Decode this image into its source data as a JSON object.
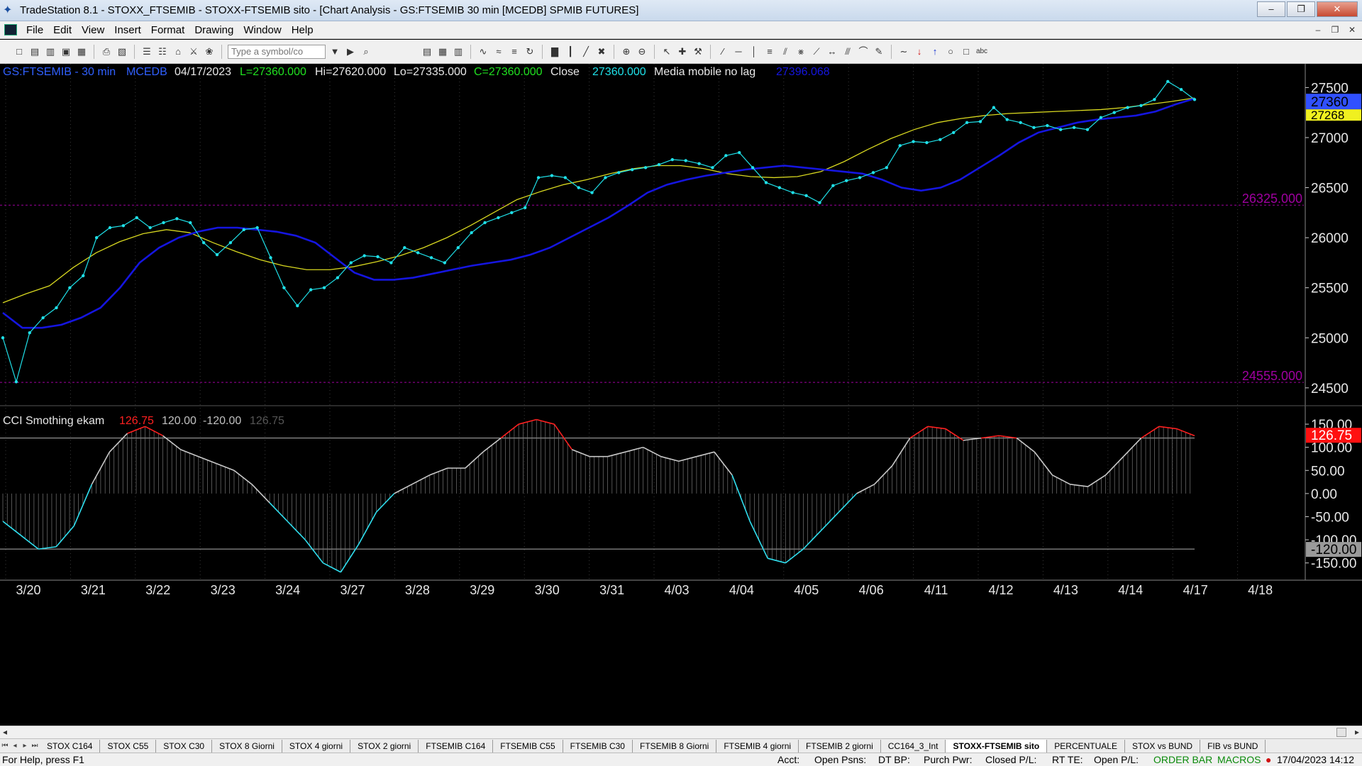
{
  "window": {
    "title": "TradeStation 8.1 - STOXX_FTSEMIB - STOXX-FTSEMIB sito - [Chart Analysis - GS:FTSEMIB  30 min  [MCEDB] SPMIB FUTURES]"
  },
  "menu": [
    "File",
    "Edit",
    "View",
    "Insert",
    "Format",
    "Drawing",
    "Window",
    "Help"
  ],
  "toolbar": {
    "symbol_placeholder": "Type a symbol/co"
  },
  "chart_header": {
    "symbol": "GS:FTSEMIB - 30 min",
    "exchange": "MCEDB",
    "date": "04/17/2023",
    "last": "L=27360.000",
    "high": "Hi=27620.000",
    "low": "Lo=27335.000",
    "close": "C=27360.000",
    "close_label": "Close",
    "close_value": "27360.000",
    "ma_label": "Media mobile no lag",
    "ma_value": "27396.068"
  },
  "cci_header": {
    "label": "CCI Smothing ekam",
    "value": "126.75",
    "upper": "120.00",
    "lower": "-120.00",
    "value2": "126.75"
  },
  "price_axis": {
    "ticks": [
      "27500",
      "27000",
      "26500",
      "26000",
      "25500",
      "25000",
      "24500"
    ],
    "tag_close": "27360",
    "tag_ma": "27268",
    "level_high": "26325.000",
    "level_low": "24555.000"
  },
  "cci_axis": {
    "ticks": [
      "150.00",
      "100.00",
      "50.00",
      "0.00",
      "-50.00",
      "-100.00",
      "-150.00"
    ],
    "tag_value": "126.75",
    "tag_lower": "-120.00"
  },
  "colors": {
    "price_dots": "#1fe0e8",
    "ma_fast": "#1515e0",
    "ma_slow": "#d8d820",
    "level_line": "#a000a0",
    "cci_pos": "#ff2020",
    "cci_neg": "#30e0f0",
    "cci_mid": "#b0b0b0"
  },
  "chart_data": [
    {
      "type": "line",
      "name": "price",
      "x_labels": [
        "3/20",
        "3/21",
        "3/22",
        "3/23",
        "3/24",
        "3/27",
        "3/28",
        "3/29",
        "3/30",
        "3/31",
        "4/03",
        "4/04",
        "4/05",
        "4/06",
        "4/11",
        "4/12",
        "4/13",
        "4/14",
        "4/17",
        "4/18"
      ],
      "ylim": [
        24350,
        27680
      ],
      "series": [
        {
          "values": [
            25000,
            24560,
            25050,
            25200,
            25300,
            25500,
            25620,
            26000,
            26100,
            26120,
            26200,
            26100,
            26150,
            26190,
            26150,
            25950,
            25830,
            25950,
            26080,
            26100,
            25800,
            25500,
            25320,
            25480,
            25500,
            25600,
            25750,
            25820,
            25810,
            25750,
            25900,
            25850,
            25800,
            25750,
            25900,
            26050,
            26150,
            26200,
            26250,
            26300,
            26600,
            26620,
            26600,
            26500,
            26450,
            26600,
            26650,
            26680,
            26700,
            26730,
            26780,
            26770,
            26740,
            26700,
            26820,
            26850,
            26700,
            26550,
            26500,
            26450,
            26420,
            26350,
            26520,
            26570,
            26600,
            26650,
            26700,
            26920,
            26960,
            26950,
            26980,
            27050,
            27150,
            27160,
            27300,
            27180,
            27150,
            27100,
            27120,
            27080,
            27100,
            27080,
            27200,
            27250,
            27300,
            27320,
            27380,
            27560,
            27480,
            27380
          ]
        },
        {
          "values": [
            25250,
            25100,
            25100,
            25130,
            25200,
            25300,
            25500,
            25750,
            25900,
            26000,
            26060,
            26100,
            26100,
            26080,
            26060,
            26020,
            25950,
            25800,
            25650,
            25580,
            25580,
            25600,
            25640,
            25680,
            25720,
            25750,
            25780,
            25830,
            25900,
            26000,
            26100,
            26200,
            26320,
            26450,
            26530,
            26580,
            26620,
            26650,
            26680,
            26700,
            26720,
            26700,
            26680,
            26660,
            26640,
            26580,
            26500,
            26470,
            26500,
            26580,
            26700,
            26820,
            26950,
            27050,
            27100,
            27150,
            27180,
            27200,
            27220,
            27260,
            27330,
            27390
          ]
        },
        {
          "values": [
            25350,
            25440,
            25520,
            25700,
            25850,
            25960,
            26040,
            26080,
            26050,
            25950,
            25860,
            25780,
            25720,
            25680,
            25680,
            25710,
            25760,
            25820,
            25900,
            26000,
            26120,
            26250,
            26380,
            26460,
            26530,
            26580,
            26640,
            26690,
            26720,
            26720,
            26690,
            26640,
            26610,
            26600,
            26610,
            26660,
            26760,
            26880,
            26990,
            27080,
            27150,
            27190,
            27220,
            27240,
            27250,
            27260,
            27270,
            27280,
            27300,
            27330,
            27360,
            27396
          ]
        }
      ]
    },
    {
      "type": "area",
      "name": "CCI",
      "ylim": [
        -175,
        170
      ],
      "levels": [
        120,
        -120
      ],
      "values": [
        -60,
        -90,
        -120,
        -115,
        -70,
        20,
        90,
        130,
        145,
        125,
        95,
        80,
        65,
        50,
        20,
        -20,
        -60,
        -100,
        -150,
        -170,
        -110,
        -40,
        0,
        20,
        40,
        55,
        55,
        90,
        120,
        150,
        160,
        150,
        95,
        80,
        80,
        90,
        100,
        80,
        70,
        80,
        90,
        40,
        -60,
        -140,
        -150,
        -120,
        -80,
        -40,
        0,
        20,
        60,
        120,
        145,
        140,
        115,
        120,
        125,
        120,
        90,
        40,
        20,
        15,
        40,
        80,
        120,
        145,
        140,
        125
      ]
    }
  ]
}
